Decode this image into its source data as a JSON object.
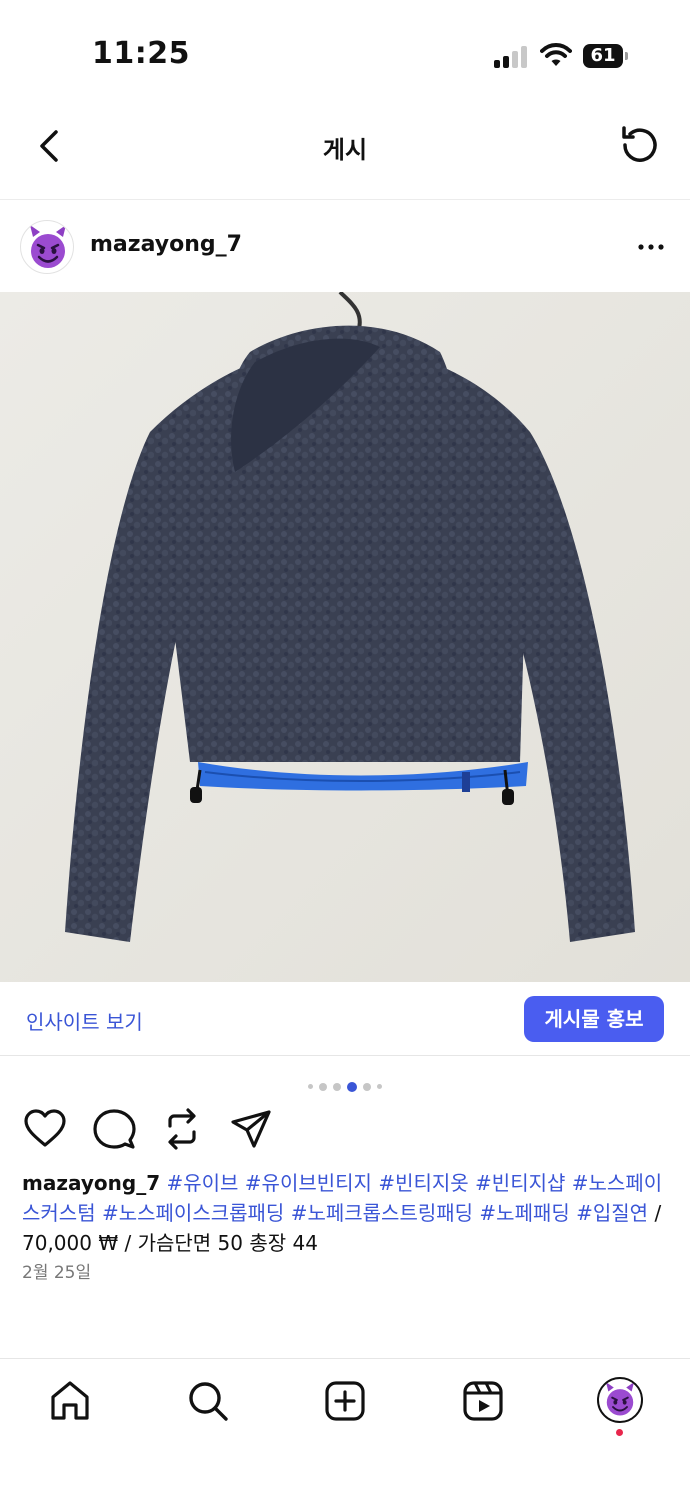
{
  "status_bar": {
    "time": "11:25",
    "battery": "61"
  },
  "header": {
    "title": "게시"
  },
  "post": {
    "username": "mazayong_7",
    "insights_label": "인사이트 보기",
    "promote_label": "게시물 홍보",
    "carousel": {
      "count": 6,
      "active_index": 3
    },
    "caption": {
      "username": "mazayong_7",
      "hashtags": [
        "#유이브",
        "#유이브빈티지",
        "#빈티지옷",
        "#빈티지샵",
        "#노스페이스커스텀",
        "#노스페이스크롭패딩",
        "#노페크롭스트링패딩",
        "#노페패딩",
        "#입질연"
      ],
      "price_text": " / 70,000 ₩ / 가슴단면 50 총장 44"
    },
    "date": "2월 25일"
  },
  "icons": {
    "back": "chevron-left-icon",
    "refresh": "refresh-icon",
    "more": "more-horizontal-icon",
    "like": "heart-icon",
    "comment": "comment-icon",
    "repost": "repost-icon",
    "share": "send-icon",
    "home": "home-icon",
    "search": "search-icon",
    "create": "plus-square-icon",
    "reels": "reels-icon",
    "profile": "avatar"
  },
  "colors": {
    "link": "#3a55d6",
    "promote": "#4a5df0",
    "notification_dot": "#e8264c"
  }
}
